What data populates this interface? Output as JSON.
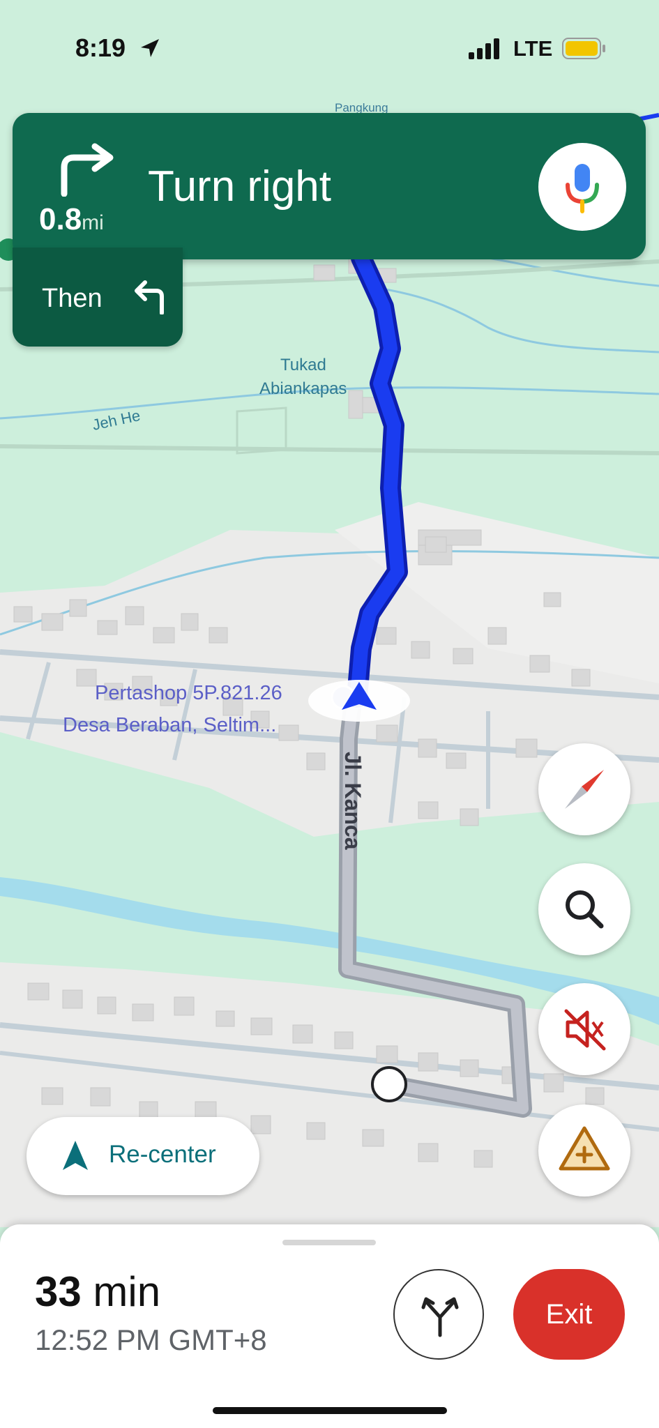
{
  "status_bar": {
    "time": "8:19",
    "network": "LTE",
    "icons": [
      "location-arrow-icon",
      "signal-icon",
      "battery-icon"
    ],
    "battery_color": "#f2c500"
  },
  "navigation": {
    "instruction": "Turn right",
    "distance_value": "0.8",
    "distance_unit": "mi",
    "next_label": "Then",
    "next_turn_icon": "turn-left-icon",
    "banner_color": "#0f6a4f"
  },
  "map": {
    "labels": {
      "area_top": "Pangkung",
      "river": "Tukad",
      "river_2": "Abiankapas",
      "road": "Jeh He",
      "street": "Jl. Kanca"
    },
    "poi": {
      "line1": "Pertashop 5P.821.26",
      "line2": "Desa Beraban, Seltim..."
    },
    "route_color": "#1a3cf0"
  },
  "controls": {
    "compass": "compass-icon",
    "search": "search-icon",
    "mute": "mute-icon",
    "report": "report-incident-icon",
    "recenter_label": "Re-center"
  },
  "trip": {
    "duration_value": "33",
    "duration_unit": "min",
    "arrival_time": "12:52 PM GMT+8",
    "exit_label": "Exit",
    "exit_color": "#d9312a"
  }
}
